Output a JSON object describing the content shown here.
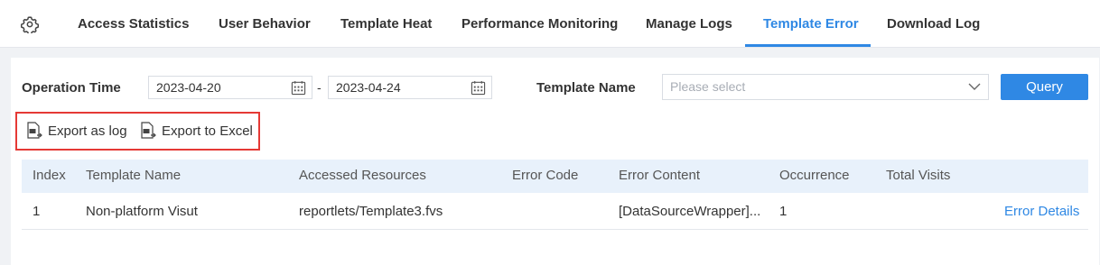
{
  "settings_icon": "gear-icon",
  "tabs": [
    {
      "label": "Access Statistics"
    },
    {
      "label": "User Behavior"
    },
    {
      "label": "Template Heat"
    },
    {
      "label": "Performance Monitoring"
    },
    {
      "label": "Manage Logs"
    },
    {
      "label": "Template Error",
      "active": true
    },
    {
      "label": "Download Log"
    }
  ],
  "filters": {
    "operation_time_label": "Operation Time",
    "start_date": "2023-04-20",
    "end_date": "2023-04-24",
    "date_separator": "-",
    "template_name_label": "Template Name",
    "template_name_placeholder": "Please select",
    "query_label": "Query"
  },
  "export": {
    "log_label": "Export as log",
    "excel_label": "Export to Excel"
  },
  "table": {
    "columns": [
      "Index",
      "Template Name",
      "Accessed Resources",
      "Error Code",
      "Error Content",
      "Occurrence",
      "Total Visits"
    ],
    "rows": [
      {
        "index": "1",
        "template_name": "Non-platform Visut",
        "accessed_resources": "reportlets/Template3.fvs",
        "error_code": "",
        "error_content": "[DataSourceWrapper]...",
        "occurrence": "1",
        "total_visits": "",
        "action": "Error Details"
      }
    ]
  },
  "colors": {
    "accent": "#2f88e4",
    "highlight_box": "#e53935",
    "table_header_bg": "#e8f1fb"
  }
}
